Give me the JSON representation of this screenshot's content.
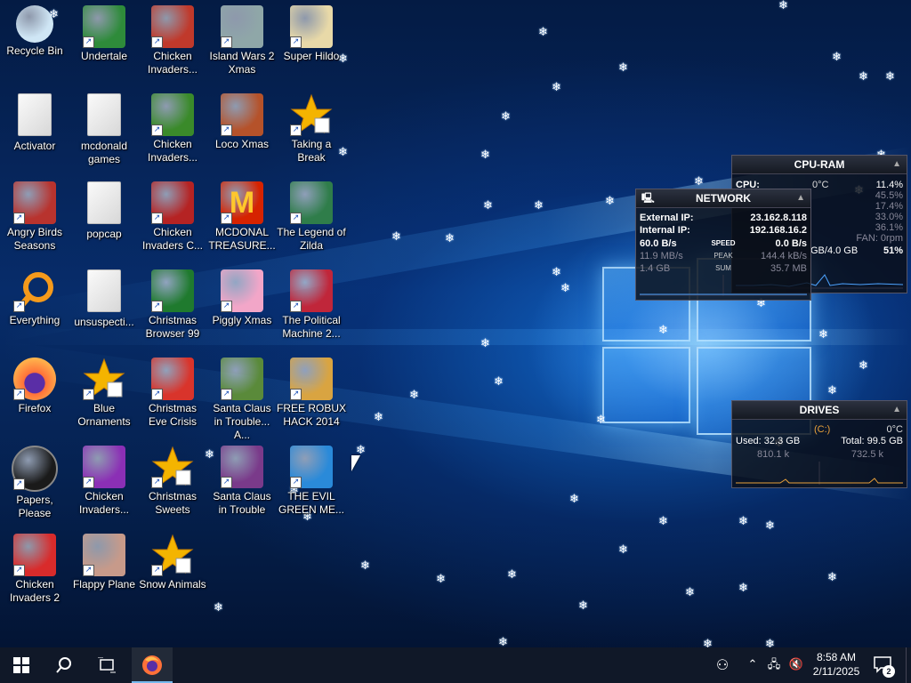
{
  "desktop": {
    "icons": [
      {
        "label": "Recycle Bin",
        "icon": "recycle-bin-icon",
        "color": "#cfe6f5",
        "shortcut": false
      },
      {
        "label": "Undertale",
        "icon": "undertale-icon",
        "color": "#2e8b3a",
        "shortcut": true
      },
      {
        "label": "Chicken Invaders...",
        "icon": "chicken-invaders-icon",
        "color": "#c0392b",
        "shortcut": true
      },
      {
        "label": "Island Wars 2 Xmas",
        "icon": "island-wars-icon",
        "color": "#8fa7a8",
        "shortcut": true
      },
      {
        "label": "Super Hildo",
        "icon": "super-hildo-icon",
        "color": "#e8d9a8",
        "shortcut": true
      },
      {
        "label": "Activator",
        "icon": "document-icon",
        "color": "#eeeeee",
        "shortcut": false
      },
      {
        "label": "mcdonald games",
        "icon": "document-icon",
        "color": "#eeeeee",
        "shortcut": false
      },
      {
        "label": "Chicken Invaders...",
        "icon": "chicken-invaders-xmas-icon",
        "color": "#3a8a2a",
        "shortcut": true
      },
      {
        "label": "Loco Xmas",
        "icon": "loco-xmas-icon",
        "color": "#b5522a",
        "shortcut": true
      },
      {
        "label": "Taking a Break",
        "icon": "star-ornament-icon",
        "color": "#f4b400",
        "shortcut": true
      },
      {
        "label": "Angry Birds Seasons",
        "icon": "angry-birds-icon",
        "color": "#b8332e",
        "shortcut": true
      },
      {
        "label": "popcap",
        "icon": "popcap-icon",
        "color": "#e6e6e6",
        "shortcut": false
      },
      {
        "label": "Chicken Invaders C...",
        "icon": "chicken-invaders-c-icon",
        "color": "#b52323",
        "shortcut": true
      },
      {
        "label": "MCDONAL TREASURE...",
        "icon": "mcdonalds-icon",
        "color": "#d62300",
        "shortcut": true
      },
      {
        "label": "The Legend of Zilda",
        "icon": "zilda-icon",
        "color": "#2f7d4a",
        "shortcut": true
      },
      {
        "label": "Everything",
        "icon": "everything-search-icon",
        "color": "#f59a1b",
        "shortcut": true
      },
      {
        "label": "unsuspecti...",
        "icon": "document-icon",
        "color": "#eeeeee",
        "shortcut": false
      },
      {
        "label": "Christmas Browser 99",
        "icon": "christmas-tree-icon",
        "color": "#1f7a2e",
        "shortcut": true
      },
      {
        "label": "Piggly Xmas",
        "icon": "piggly-icon",
        "color": "#f2a6c8",
        "shortcut": true
      },
      {
        "label": "The Political Machine 2...",
        "icon": "political-machine-icon",
        "color": "#c0263a",
        "shortcut": true
      },
      {
        "label": "Firefox",
        "icon": "firefox-icon",
        "color": "#ff7139",
        "shortcut": true
      },
      {
        "label": "Blue Ornaments",
        "icon": "star-ornament-icon",
        "color": "#f4b400",
        "shortcut": true
      },
      {
        "label": "Christmas Eve Crisis",
        "icon": "santa-icon",
        "color": "#d9342b",
        "shortcut": true
      },
      {
        "label": "Santa Claus in Trouble... A...",
        "icon": "santa-trouble-icon",
        "color": "#5a8a3a",
        "shortcut": true
      },
      {
        "label": "FREE ROBUX HACK 2014",
        "icon": "installer-box-icon",
        "color": "#d9a441",
        "shortcut": true
      },
      {
        "label": "Papers, Please",
        "icon": "papers-please-icon",
        "color": "#1a1a1a",
        "shortcut": true
      },
      {
        "label": "Chicken Invaders...",
        "icon": "chicken-invaders-3-icon",
        "color": "#8b2fb5",
        "shortcut": true
      },
      {
        "label": "Christmas Sweets",
        "icon": "star-ornament-icon",
        "color": "#f4b400",
        "shortcut": true
      },
      {
        "label": "Santa Claus in Trouble",
        "icon": "santa-trouble-icon",
        "color": "#7a3a8a",
        "shortcut": true
      },
      {
        "label": "THE EVIL GREEN ME...",
        "icon": "evil-green-men-icon",
        "color": "#2a8ad9",
        "shortcut": true
      },
      {
        "label": "Chicken Invaders 2",
        "icon": "chicken-invaders-2-icon",
        "color": "#d92b2b",
        "shortcut": true
      },
      {
        "label": "Flappy Plane",
        "icon": "flappy-plane-icon",
        "color": "#c79a8a",
        "shortcut": true
      },
      {
        "label": "Snow Animals",
        "icon": "star-ornament-icon",
        "color": "#f4b400",
        "shortcut": true
      }
    ]
  },
  "widgets": {
    "cpu_ram": {
      "title": "CPU-RAM",
      "cpu_label": "CPU:",
      "cpu_temp": "0°C",
      "cpu_value": "11.4%",
      "cores": [
        "45.5%",
        "17.4%",
        "33.0%",
        "36.1%"
      ],
      "fan": "FAN: 0rpm",
      "ram_used": "GB/4.0 GB",
      "ram_percent": "51%"
    },
    "network": {
      "title": "NETWORK",
      "external_label": "External IP:",
      "external_ip": "23.162.8.118",
      "internal_label": "Internal IP:",
      "internal_ip": "192.168.16.2",
      "down_speed": "60.0 B/s",
      "speed_label": "SPEED",
      "up_speed": "0.0 B/s",
      "down_peak": "11.9 MB/s",
      "peak_label": "PEAK",
      "up_peak": "144.4 kB/s",
      "down_sum": "1.4 GB",
      "sum_label": "SUM",
      "up_sum": "35.7 MB"
    },
    "drives": {
      "title": "DRIVES",
      "drive_letter": "(C:)",
      "temp": "0°C",
      "used": "Used: 32.3 GB",
      "total": "Total: 99.5 GB",
      "read": "810.1 k",
      "write": "732.5 k"
    }
  },
  "taskbar": {
    "time": "8:58 AM",
    "date": "2/11/2025",
    "notifications": "2"
  },
  "colors": {
    "taskbar": "#101828",
    "accent": "#4da3ff",
    "label_text": "#ffffff"
  }
}
